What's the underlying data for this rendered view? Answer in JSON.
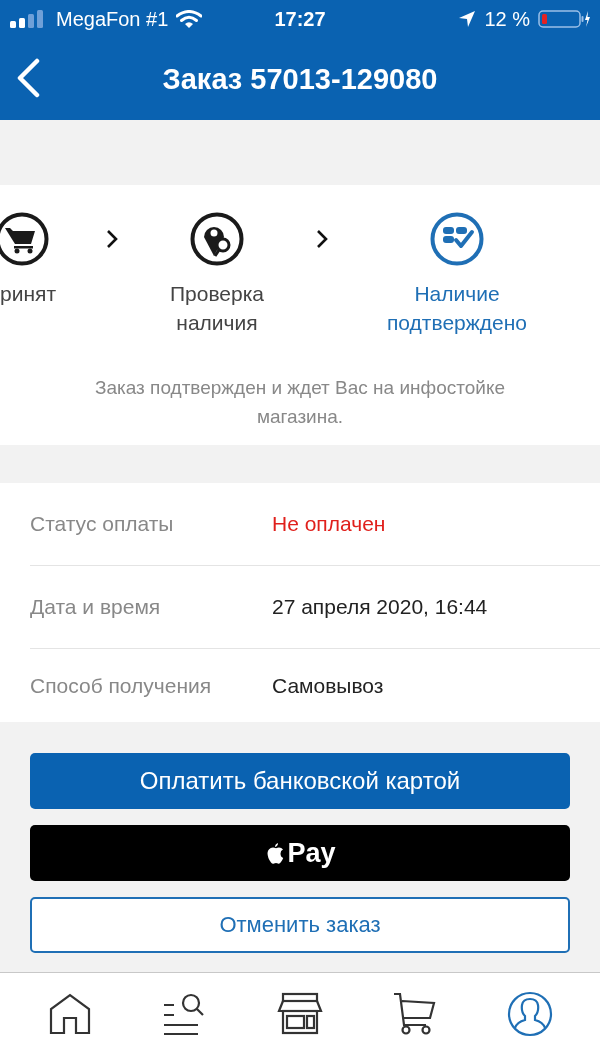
{
  "status_bar": {
    "carrier": "MegaFon #1",
    "time": "17:27",
    "battery": "12 %"
  },
  "header": {
    "title": "Заказ 57013-129080"
  },
  "steps": [
    {
      "kind": "cart",
      "label": "ринят",
      "active": false
    },
    {
      "kind": "search",
      "label": "Проверка наличия",
      "active": false
    },
    {
      "kind": "confirmed",
      "label": "Наличие подтверждено",
      "active": true
    }
  ],
  "step_note": "Заказ подтвержден и ждет Вас на инфостойке магазина.",
  "details": [
    {
      "label": "Статус оплаты",
      "value": "Не оплачен",
      "color": "#e0201c"
    },
    {
      "label": "Дата и время",
      "value": "27 апреля 2020, 16:44",
      "color": "#222222"
    },
    {
      "label": "Способ получения",
      "value": "Самовывоз",
      "color": "#222222"
    }
  ],
  "actions": [
    {
      "kind": "primary",
      "label": "Оплатить банковской картой"
    },
    {
      "kind": "applepay",
      "label": "Pay"
    },
    {
      "kind": "outline",
      "label": "Отменить заказ"
    }
  ],
  "tab_bar": [
    {
      "kind": "home",
      "selected": false
    },
    {
      "kind": "catalog",
      "selected": false
    },
    {
      "kind": "store",
      "selected": false
    },
    {
      "kind": "cart",
      "selected": false
    },
    {
      "kind": "profile",
      "selected": true
    }
  ]
}
